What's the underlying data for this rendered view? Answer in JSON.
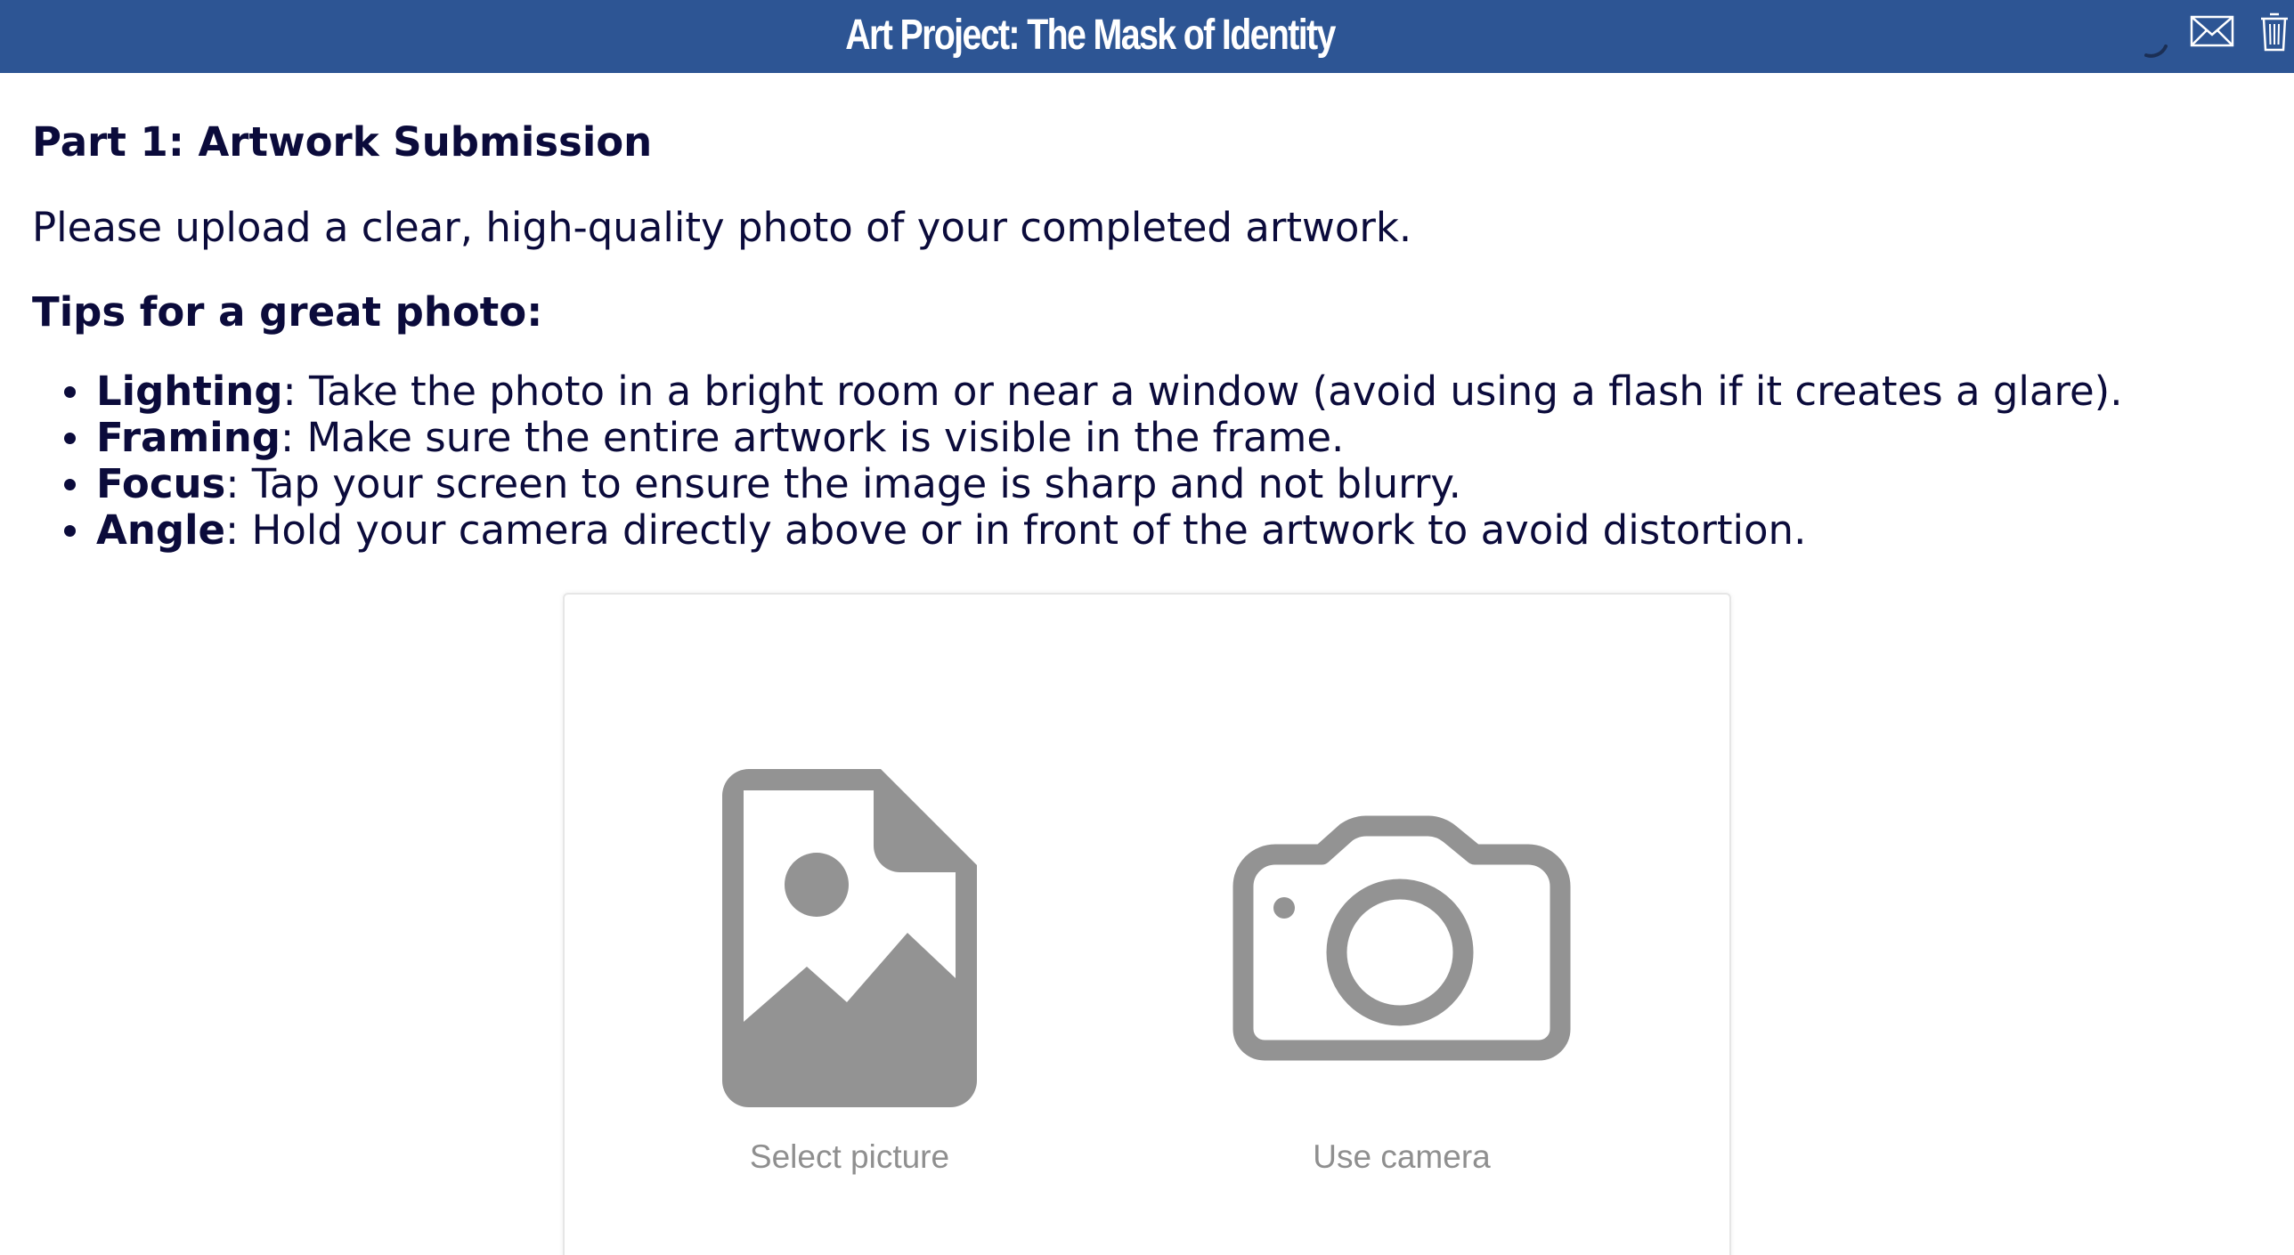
{
  "header": {
    "title": "Art Project: The Mask of Identity",
    "background_color": "#2d5594",
    "icons": [
      "loading-spinner-icon",
      "mail-icon",
      "trash-icon"
    ]
  },
  "content": {
    "section_title": "Part 1: Artwork Submission",
    "intro": "Please upload a clear, high-quality photo of your completed artwork.",
    "tips_title": "Tips for a great photo:",
    "tips": [
      {
        "term": "Lighting",
        "text": ": Take the photo in a bright room or near a window (avoid using a flash if it creates a glare)."
      },
      {
        "term": "Framing",
        "text": ": Make sure the entire artwork is visible in the frame."
      },
      {
        "term": "Focus",
        "text": ": Tap your screen to ensure the image is sharp and not blurry."
      },
      {
        "term": "Angle",
        "text": ": Hold your camera directly above or in front of the artwork to avoid distortion."
      }
    ]
  },
  "upload": {
    "select_picture_label": "Select picture",
    "use_camera_label": "Use camera",
    "icon_color": "#939393",
    "icons": [
      "image-file-icon",
      "camera-icon"
    ]
  }
}
